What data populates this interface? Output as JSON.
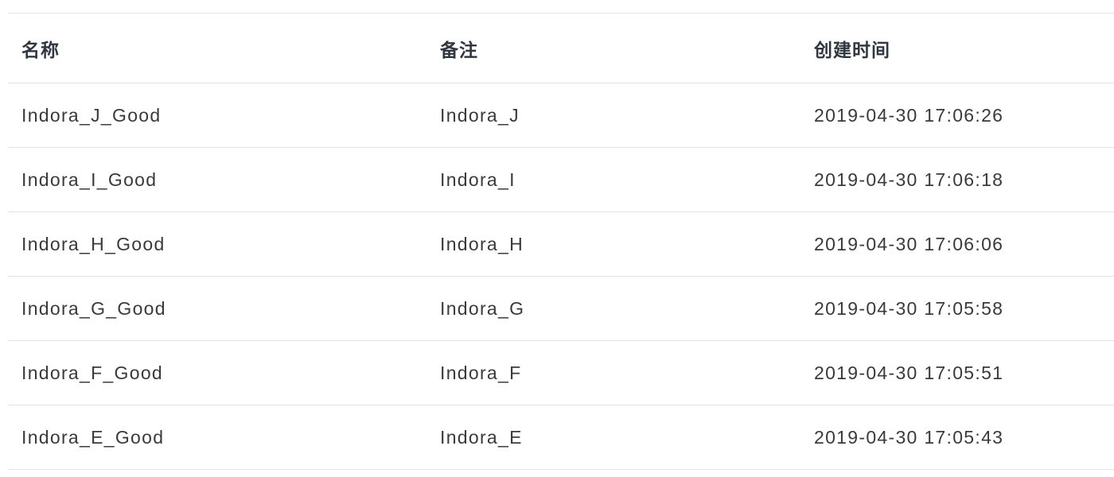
{
  "table": {
    "columns": [
      "名称",
      "备注",
      "创建时间"
    ],
    "rows": [
      {
        "name": "Indora_J_Good",
        "note": "Indora_J",
        "created": "2019-04-30 17:06:26"
      },
      {
        "name": "Indora_I_Good",
        "note": "Indora_I",
        "created": "2019-04-30 17:06:18"
      },
      {
        "name": "Indora_H_Good",
        "note": "Indora_H",
        "created": "2019-04-30 17:06:06"
      },
      {
        "name": "Indora_G_Good",
        "note": "Indora_G",
        "created": "2019-04-30 17:05:58"
      },
      {
        "name": "Indora_F_Good",
        "note": "Indora_F",
        "created": "2019-04-30 17:05:51"
      },
      {
        "name": "Indora_E_Good",
        "note": "Indora_E",
        "created": "2019-04-30 17:05:43"
      }
    ]
  }
}
